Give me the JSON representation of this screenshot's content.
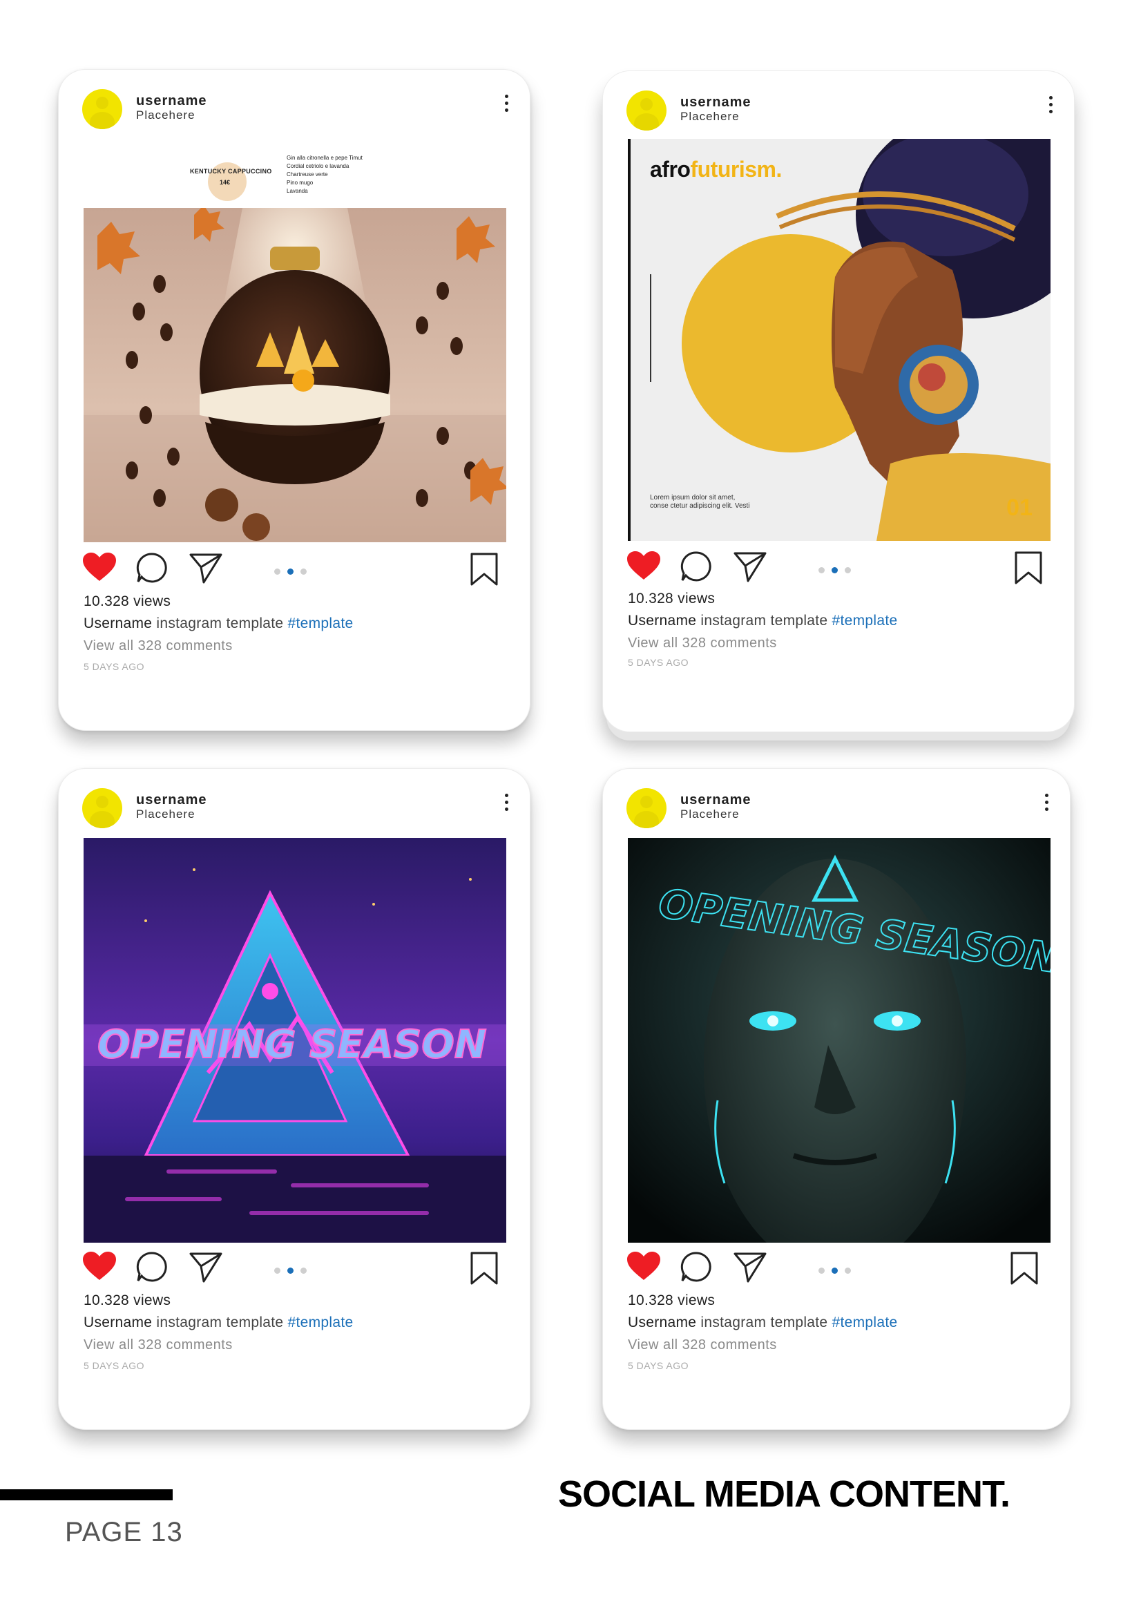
{
  "posts": [
    {
      "username": "username",
      "place": "Placehere",
      "views": "10.328 views",
      "caption_user": "Username",
      "caption_text": " instagram template ",
      "caption_tag": "#template",
      "comments": "View all 328 comments",
      "ago": "5 DAYS AGO",
      "menu": {
        "title": "KENTUCKY CAPPUCCINO",
        "price": "14€",
        "items": [
          "Gin alla citronella e pepe Timut",
          "Cordial cetriolo e lavanda",
          "Chartreuse verte",
          "Pino mugo",
          "Lavanda"
        ]
      }
    },
    {
      "username": "username",
      "place": "Placehere",
      "views": "10.328 views",
      "caption_user": "Username",
      "caption_text": " instagram template ",
      "caption_tag": "#template",
      "comments": "View all 328 comments",
      "ago": "5 DAYS AGO",
      "overlay": {
        "title_a": "afro",
        "title_b": "futurism.",
        "lorem": "Lorem ipsum dolor sit amet, conse ctetur adipiscing elit. Vesti",
        "number": "01"
      }
    },
    {
      "username": "username",
      "place": "Placehere",
      "views": "10.328 views",
      "caption_user": "Username",
      "caption_text": " instagram template ",
      "caption_tag": "#template",
      "comments": "View all 328 comments",
      "ago": "5 DAYS AGO"
    },
    {
      "username": "username",
      "place": "Placehere",
      "views": "10.328 views",
      "caption_user": "Username",
      "caption_text": " instagram template ",
      "caption_tag": "#template",
      "comments": "View all 328 comments",
      "ago": "5 DAYS AGO"
    }
  ],
  "footer": {
    "page": "PAGE 13",
    "section_title": "SOCIAL MEDIA CONTENT."
  },
  "colors": {
    "accent_blue": "#1b6fb8",
    "heart_red": "#ee1d24",
    "avatar_yellow": "#f2e400",
    "afro_yellow": "#f2b416"
  }
}
